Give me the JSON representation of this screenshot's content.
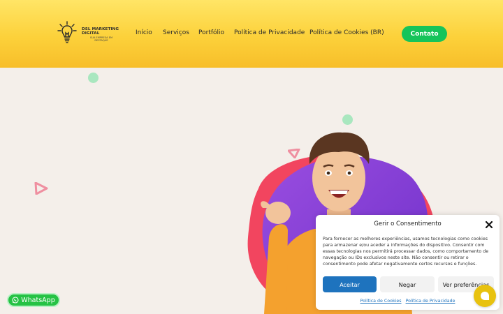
{
  "header": {
    "logo": {
      "text": "DSL MARKETING DIGITAL",
      "tagline": "SUA EMPRESA EM DESTAQUE"
    },
    "nav": [
      {
        "label": "Início"
      },
      {
        "label": "Serviços"
      },
      {
        "label": "Portfólio"
      },
      {
        "label": "Política de Privacidade"
      },
      {
        "label": "Política de Cookies (BR)"
      }
    ],
    "contact_label": "Contato"
  },
  "whatsapp": {
    "label": "WhatsApp"
  },
  "consent": {
    "title": "Gerir o Consentimento",
    "body": "Para fornecer as melhores experiências, usamos tecnologias como cookies para armazenar e/ou aceder a informações do dispositivo. Consentir com essas tecnologias nos permitirá processar dados, como comportamento de navegação ou IDs exclusivos neste site. Não consentir ou retirar o consentimento pode afetar negativamente certos recursos e funções.",
    "accept_label": "Aceitar",
    "deny_label": "Negar",
    "prefs_label": "Ver preferências",
    "cookie_policy_link": "Política de Cookies",
    "privacy_policy_link": "Política de Privacidade"
  },
  "colors": {
    "header_yellow": "#fcd13a",
    "contact_green": "#16c45a",
    "accept_blue": "#1e73be",
    "chat_yellow": "#e8c20f"
  },
  "icons": [
    "lightbulb-logo-icon",
    "whatsapp-icon",
    "close-icon",
    "chat-icon"
  ]
}
